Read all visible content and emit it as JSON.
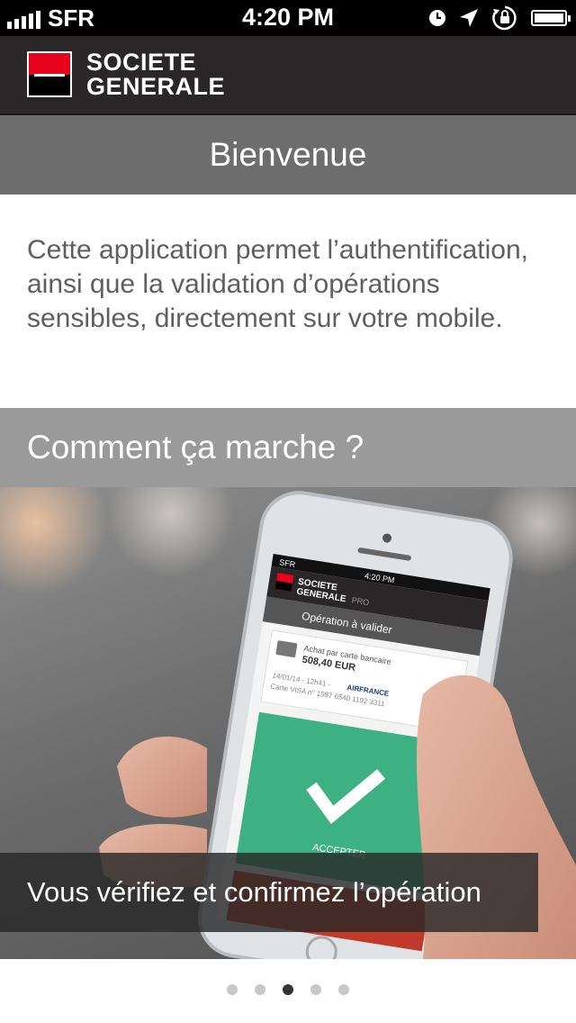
{
  "status_bar": {
    "carrier": "SFR",
    "time": "4:20 PM",
    "icons": [
      "signal-bars-icon",
      "alarm-icon",
      "location-arrow-icon",
      "rotation-lock-icon",
      "battery-icon"
    ]
  },
  "header": {
    "logo_line1": "SOCIETE",
    "logo_line2": "GENERALE",
    "brand_red": "#e9041e"
  },
  "welcome": {
    "title": "Bienvenue",
    "text": "Cette application permet l’authentification, ainsi que la validation d’opérations sensibles, directement sur votre mobile."
  },
  "how_it_works": {
    "title": "Comment ça marche ?"
  },
  "photo": {
    "phone_status_carrier": "SFR",
    "phone_status_time": "4:20 PM",
    "phone_logo_line1": "SOCIETE",
    "phone_logo_line2": "GENERALE",
    "phone_logo_suffix": "PRO",
    "phone_screen_title": "Opération à valider",
    "txn_title": "Achat par carte bancaire",
    "txn_amount": "508,40 EUR",
    "txn_date": "14/01/14 - 12h41 -",
    "txn_merchant": "AIRFRANCE",
    "txn_card": "Carte VISA n° 1987 6540 1192 3311",
    "accept_label": "ACCEPTER",
    "accept_color": "#3db183"
  },
  "carousel": {
    "caption": "Vous vérifiez et confirmez l’opération",
    "page_count": 5,
    "active_page": 3
  }
}
